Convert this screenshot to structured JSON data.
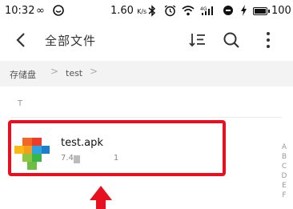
{
  "status_bar": {
    "time": "10:32",
    "network_speed": "1.60",
    "network_speed_unit": "K/s",
    "battery_level": "100",
    "icons": [
      "infinity-icon",
      "app-notification-icon",
      "bluetooth-icon",
      "alarm-icon",
      "wifi-icon",
      "signal-4g-icon",
      "no-disturb-icon",
      "charging-icon",
      "battery-icon"
    ]
  },
  "header": {
    "title": "全部文件",
    "icons": [
      "back-arrow-icon",
      "sort-icon",
      "search-icon",
      "more-vertical-icon"
    ]
  },
  "breadcrumb": {
    "items": [
      "存储盘",
      "test"
    ],
    "separator": ">"
  },
  "section": {
    "letter": "T"
  },
  "files": [
    {
      "name": "test.apk",
      "meta": "7.4",
      "meta_tail": "1",
      "icon": "apk-file-icon"
    }
  ],
  "index_bar": [
    "A",
    "B",
    "C",
    "D",
    "E",
    "F"
  ],
  "colors": {
    "highlight": "#e8101e",
    "breadcrumb_bg": "#f3f3f3"
  }
}
